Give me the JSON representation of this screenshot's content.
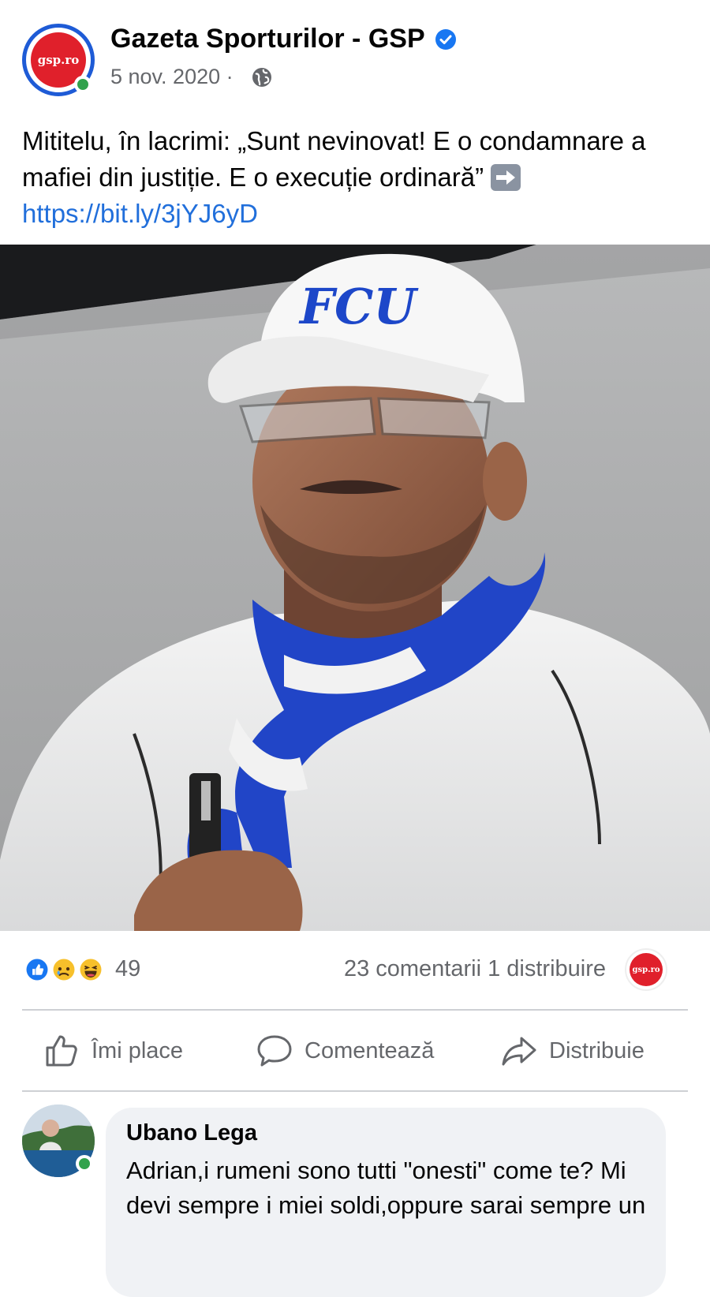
{
  "post": {
    "page_name": "Gazeta Sporturilor - GSP",
    "avatar_text": "gsp.ro",
    "date": "5 nov. 2020 ·",
    "text": "Mititelu, în lacrimi: „Sunt nevinovat! E o condamnare a mafiei din justiție. E o execuție ordinară” ",
    "link": "https://bit.ly/3jYJ6yD",
    "photo_cap_text": "FCU"
  },
  "stats": {
    "reaction_count": "49",
    "comments_shares": "23 comentarii 1 distribuire",
    "share_avatar_text": "gsp.ro",
    "reaction_icons": [
      "like-icon",
      "sad-icon",
      "haha-icon"
    ]
  },
  "actions": {
    "like": "Îmi place",
    "comment": "Comentează",
    "share": "Distribuie"
  },
  "comment": {
    "name": "Ubano Lega",
    "text": "Adrian,i rumeni sono tutti \"onesti\" come te? Mi devi sempre i miei soldi,oppure sarai sempre un"
  },
  "colors": {
    "link": "#216fdb",
    "verified": "#1877f2",
    "online": "#31a24c",
    "brand_red": "#e0202b"
  }
}
